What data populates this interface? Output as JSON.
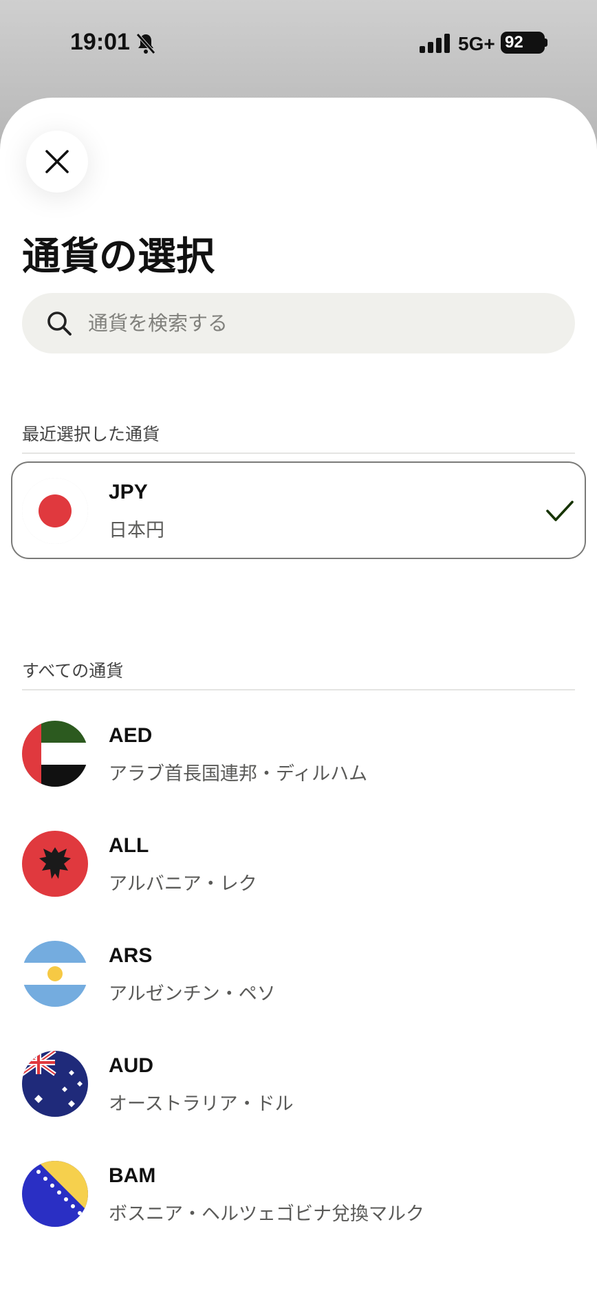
{
  "status_bar": {
    "time": "19:01",
    "network": "5G+",
    "battery": "92"
  },
  "sheet": {
    "title": "通貨の選択",
    "search": {
      "placeholder": "通貨を検索する",
      "value": ""
    },
    "recent_section": {
      "label": "最近選択した通貨",
      "items": [
        {
          "code": "JPY",
          "name": "日本円",
          "flag": "japan-flag",
          "selected": true
        }
      ]
    },
    "all_section": {
      "label": "すべての通貨",
      "items": [
        {
          "code": "AED",
          "name": "アラブ首長国連邦・ディルハム",
          "flag": "uae-flag"
        },
        {
          "code": "ALL",
          "name": "アルバニア・レク",
          "flag": "albania-flag"
        },
        {
          "code": "ARS",
          "name": "アルゼンチン・ペソ",
          "flag": "argentina-flag"
        },
        {
          "code": "AUD",
          "name": "オーストラリア・ドル",
          "flag": "australia-flag"
        },
        {
          "code": "BAM",
          "name": "ボスニア・ヘルツェゴビナ兌換マルク",
          "flag": "bosnia-flag"
        }
      ]
    }
  },
  "icons": {
    "close": "close-icon",
    "search": "search-icon",
    "check": "check-icon",
    "silent": "bell-slash-icon",
    "signal": "signal-icon"
  },
  "colors": {
    "accent_check": "#163300",
    "search_bg": "#f0f0ec",
    "japan_red": "#e0393e"
  }
}
